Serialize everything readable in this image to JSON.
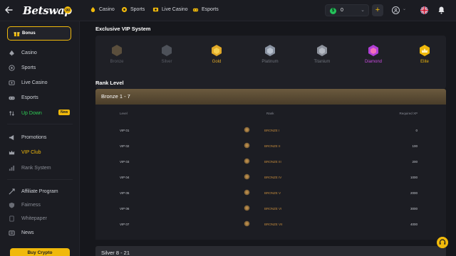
{
  "header": {
    "logo_text": "Betswap",
    "logo_badge": "gg",
    "nav": [
      {
        "label": "Casino",
        "icon": "casino-icon"
      },
      {
        "label": "Sports",
        "icon": "sports-icon"
      },
      {
        "label": "Live Casino",
        "icon": "live-casino-icon"
      },
      {
        "label": "Esports",
        "icon": "esports-icon"
      }
    ],
    "wallet_amount": "0",
    "wallet_coin_symbol": "$"
  },
  "sidebar": {
    "bonus_label": "Bonus",
    "items": [
      {
        "label": "Casino",
        "icon": "spade-icon"
      },
      {
        "label": "Sports",
        "icon": "soccer-ball-icon"
      },
      {
        "label": "Live Casino",
        "icon": "live-icon"
      },
      {
        "label": "Esports",
        "icon": "gamepad-icon"
      },
      {
        "label": "Up Down",
        "icon": "updown-icon",
        "badge": "New"
      },
      {
        "label": "Promotions",
        "icon": "megaphone-icon"
      },
      {
        "label": "VIP Club",
        "icon": "crown-icon"
      },
      {
        "label": "Rank System",
        "icon": "rank-icon"
      },
      {
        "label": "Affiliate Program",
        "icon": "affiliate-icon"
      },
      {
        "label": "Fairness",
        "icon": "fairness-icon"
      },
      {
        "label": "Whitepaper",
        "icon": "document-icon"
      },
      {
        "label": "News",
        "icon": "news-icon"
      }
    ],
    "buy_crypto_label": "Buy Crypto"
  },
  "vip": {
    "title": "Exclusive VIP System",
    "tiers": [
      {
        "label": "Bronze",
        "color": "#7a6b52",
        "active": false
      },
      {
        "label": "Silver",
        "color": "#6f747c",
        "active": false
      },
      {
        "label": "Gold",
        "color": "#e0a828",
        "active": true
      },
      {
        "label": "Platinum",
        "color": "#a9b3c2",
        "active": false
      },
      {
        "label": "Titanium",
        "color": "#a9aeb8",
        "active": false
      },
      {
        "label": "Diamond",
        "color": "#c94be0",
        "active": true
      },
      {
        "label": "Elite",
        "color": "#f0b90b",
        "active": true
      }
    ]
  },
  "rank": {
    "title": "Rank Level",
    "group_label": "Bronze 1 - 7",
    "columns": [
      "Level",
      "Rank",
      "Required XP"
    ],
    "rows": [
      {
        "level": "VIP 01",
        "rank": "BRONZE I",
        "xp": "0"
      },
      {
        "level": "VIP 02",
        "rank": "BRONZE II",
        "xp": "100"
      },
      {
        "level": "VIP 03",
        "rank": "BRONZE III",
        "xp": "200"
      },
      {
        "level": "VIP 04",
        "rank": "BRONZE IV",
        "xp": "1000"
      },
      {
        "level": "VIP 05",
        "rank": "BRONZE V",
        "xp": "2000"
      },
      {
        "level": "VIP 06",
        "rank": "BRONZE VI",
        "xp": "3000"
      },
      {
        "level": "VIP 07",
        "rank": "BRONZE VII",
        "xp": "4000"
      }
    ],
    "next_group_label": "Silver  8 - 21"
  },
  "colors": {
    "accent": "#f0b90b",
    "bronze_text": "#c28a3c",
    "new_green": "#2ecc55"
  }
}
